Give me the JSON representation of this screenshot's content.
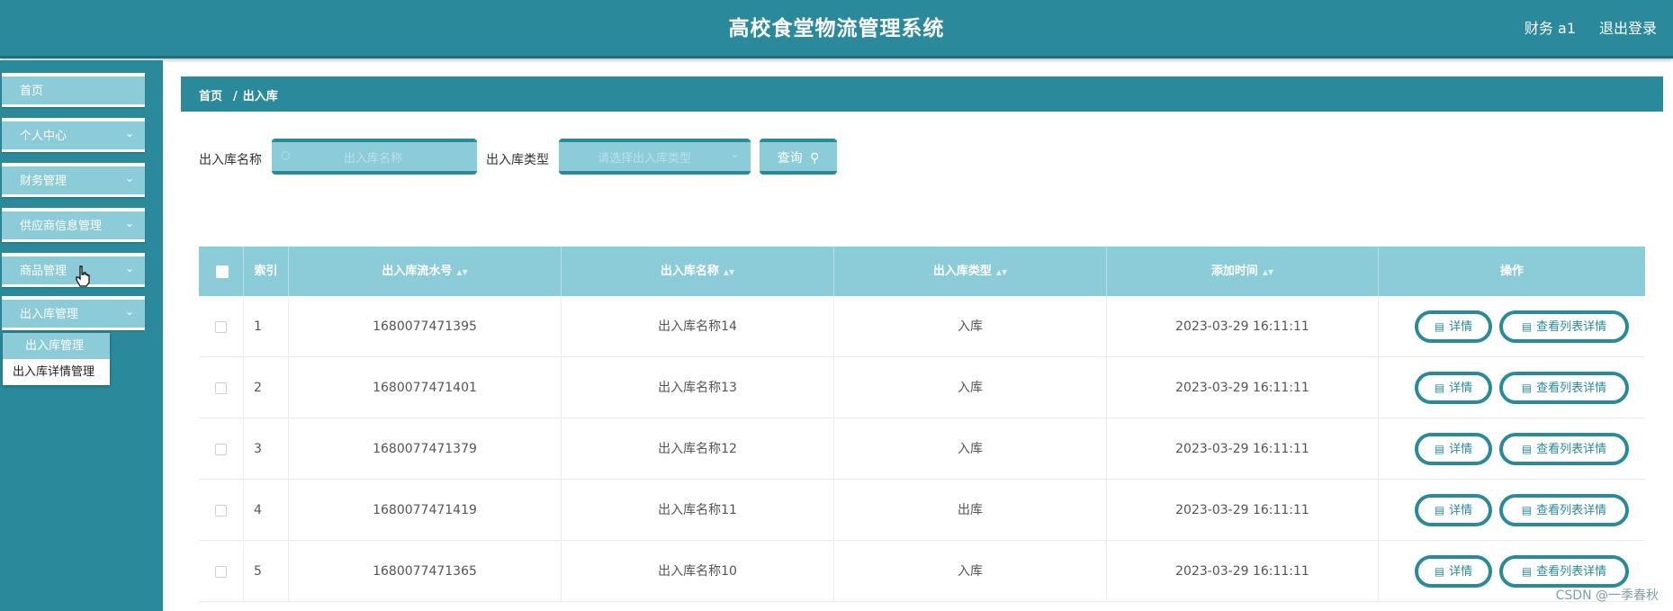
{
  "header": {
    "title": "高校食堂物流管理系统",
    "user": "财务 a1",
    "logout": "退出登录"
  },
  "sidebar": {
    "items": [
      {
        "label": "首页"
      },
      {
        "label": "个人中心"
      },
      {
        "label": "财务管理"
      },
      {
        "label": "供应商信息管理"
      },
      {
        "label": "商品管理"
      },
      {
        "label": "出入库管理"
      }
    ],
    "submenu": [
      {
        "label": "出入库管理"
      },
      {
        "label": "出入库详情管理"
      }
    ]
  },
  "breadcrumb": {
    "home": "首页",
    "separator": "/",
    "current": "出入库"
  },
  "search": {
    "name_label": "出入库名称",
    "name_placeholder": "出入库名称",
    "type_label": "出入库类型",
    "type_placeholder": "请选择出入库类型",
    "button": "查询"
  },
  "table": {
    "columns": {
      "index": "索引",
      "serial": "出入库流水号",
      "name": "出入库名称",
      "type": "出入库类型",
      "time": "添加时间",
      "ops": "操作"
    },
    "rows": [
      {
        "index": "1",
        "serial": "1680077471395",
        "name": "出入库名称14",
        "type": "入库",
        "time": "2023-03-29 16:11:11"
      },
      {
        "index": "2",
        "serial": "1680077471401",
        "name": "出入库名称13",
        "type": "入库",
        "time": "2023-03-29 16:11:11"
      },
      {
        "index": "3",
        "serial": "1680077471379",
        "name": "出入库名称12",
        "type": "入库",
        "time": "2023-03-29 16:11:11"
      },
      {
        "index": "4",
        "serial": "1680077471419",
        "name": "出入库名称11",
        "type": "出库",
        "time": "2023-03-29 16:11:11"
      },
      {
        "index": "5",
        "serial": "1680077471365",
        "name": "出入库名称10",
        "type": "入库",
        "time": "2023-03-29 16:11:11"
      }
    ],
    "detail_button": "详情",
    "list_detail_button": "查看列表详情"
  },
  "watermark": "CSDN @一季春秋",
  "colors": {
    "primary": "#2a8a9c",
    "light": "#8cccd8"
  }
}
